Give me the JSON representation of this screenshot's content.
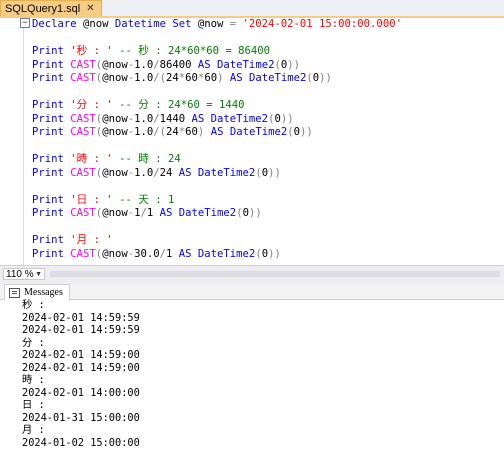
{
  "tab": {
    "title": "SQLQuery1.sql",
    "close_glyph": "✕"
  },
  "editor": {
    "lines": [
      [
        [
          "kw",
          "Declare "
        ],
        [
          "var",
          "@now "
        ],
        [
          "kw",
          "Datetime "
        ],
        [
          "kw",
          "Set "
        ],
        [
          "var",
          "@now "
        ],
        [
          "op",
          "= "
        ],
        [
          "str",
          "'2024-02-01 15:00:00.000'"
        ]
      ],
      [],
      [
        [
          "kw",
          "Print "
        ],
        [
          "str",
          "'秒 : ' "
        ],
        [
          "cm",
          "-- 秒 : 24*60*60 = 86400"
        ]
      ],
      [
        [
          "kw",
          "Print "
        ],
        [
          "fn",
          "CAST"
        ],
        [
          "op",
          "("
        ],
        [
          "var",
          "@now"
        ],
        [
          "op",
          "-"
        ],
        [
          "var",
          "1.0"
        ],
        [
          "op",
          "/"
        ],
        [
          "var",
          "86400 "
        ],
        [
          "kw",
          "AS "
        ],
        [
          "kw",
          "DateTime2"
        ],
        [
          "op",
          "("
        ],
        [
          "var",
          "0"
        ],
        [
          "op",
          "))"
        ]
      ],
      [
        [
          "kw",
          "Print "
        ],
        [
          "fn",
          "CAST"
        ],
        [
          "op",
          "("
        ],
        [
          "var",
          "@now"
        ],
        [
          "op",
          "-"
        ],
        [
          "var",
          "1.0"
        ],
        [
          "op",
          "/("
        ],
        [
          "var",
          "24"
        ],
        [
          "op",
          "*"
        ],
        [
          "var",
          "60"
        ],
        [
          "op",
          "*"
        ],
        [
          "var",
          "60"
        ],
        [
          "op",
          ") "
        ],
        [
          "kw",
          "AS "
        ],
        [
          "kw",
          "DateTime2"
        ],
        [
          "op",
          "("
        ],
        [
          "var",
          "0"
        ],
        [
          "op",
          "))"
        ]
      ],
      [],
      [
        [
          "kw",
          "Print "
        ],
        [
          "str",
          "'分 : ' "
        ],
        [
          "cm",
          "-- 分 : 24*60 = 1440"
        ]
      ],
      [
        [
          "kw",
          "Print "
        ],
        [
          "fn",
          "CAST"
        ],
        [
          "op",
          "("
        ],
        [
          "var",
          "@now"
        ],
        [
          "op",
          "-"
        ],
        [
          "var",
          "1.0"
        ],
        [
          "op",
          "/"
        ],
        [
          "var",
          "1440 "
        ],
        [
          "kw",
          "AS "
        ],
        [
          "kw",
          "DateTime2"
        ],
        [
          "op",
          "("
        ],
        [
          "var",
          "0"
        ],
        [
          "op",
          "))"
        ]
      ],
      [
        [
          "kw",
          "Print "
        ],
        [
          "fn",
          "CAST"
        ],
        [
          "op",
          "("
        ],
        [
          "var",
          "@now"
        ],
        [
          "op",
          "-"
        ],
        [
          "var",
          "1.0"
        ],
        [
          "op",
          "/("
        ],
        [
          "var",
          "24"
        ],
        [
          "op",
          "*"
        ],
        [
          "var",
          "60"
        ],
        [
          "op",
          ") "
        ],
        [
          "kw",
          "AS "
        ],
        [
          "kw",
          "DateTime2"
        ],
        [
          "op",
          "("
        ],
        [
          "var",
          "0"
        ],
        [
          "op",
          "))"
        ]
      ],
      [],
      [
        [
          "kw",
          "Print "
        ],
        [
          "str",
          "'時 : ' "
        ],
        [
          "cm",
          "-- 時 : 24"
        ]
      ],
      [
        [
          "kw",
          "Print "
        ],
        [
          "fn",
          "CAST"
        ],
        [
          "op",
          "("
        ],
        [
          "var",
          "@now"
        ],
        [
          "op",
          "-"
        ],
        [
          "var",
          "1.0"
        ],
        [
          "op",
          "/"
        ],
        [
          "var",
          "24 "
        ],
        [
          "kw",
          "AS "
        ],
        [
          "kw",
          "DateTime2"
        ],
        [
          "op",
          "("
        ],
        [
          "var",
          "0"
        ],
        [
          "op",
          "))"
        ]
      ],
      [],
      [
        [
          "kw",
          "Print "
        ],
        [
          "str",
          "'日 : ' "
        ],
        [
          "cm",
          "-- 天 : 1"
        ]
      ],
      [
        [
          "kw",
          "Print "
        ],
        [
          "fn",
          "CAST"
        ],
        [
          "op",
          "("
        ],
        [
          "var",
          "@now"
        ],
        [
          "op",
          "-"
        ],
        [
          "var",
          "1"
        ],
        [
          "op",
          "/"
        ],
        [
          "var",
          "1 "
        ],
        [
          "kw",
          "AS "
        ],
        [
          "kw",
          "DateTime2"
        ],
        [
          "op",
          "("
        ],
        [
          "var",
          "0"
        ],
        [
          "op",
          "))"
        ]
      ],
      [],
      [
        [
          "kw",
          "Print "
        ],
        [
          "str",
          "'月 : '"
        ]
      ],
      [
        [
          "kw",
          "Print "
        ],
        [
          "fn",
          "CAST"
        ],
        [
          "op",
          "("
        ],
        [
          "var",
          "@now"
        ],
        [
          "op",
          "-"
        ],
        [
          "var",
          "30.0"
        ],
        [
          "op",
          "/"
        ],
        [
          "var",
          "1 "
        ],
        [
          "kw",
          "AS "
        ],
        [
          "kw",
          "DateTime2"
        ],
        [
          "op",
          "("
        ],
        [
          "var",
          "0"
        ],
        [
          "op",
          "))"
        ]
      ]
    ]
  },
  "zoom": {
    "value": "110 %"
  },
  "results": {
    "tab_label": "Messages",
    "messages": [
      "秒 :",
      "2024-02-01 14:59:59",
      "2024-02-01 14:59:59",
      "分 :",
      "2024-02-01 14:59:00",
      "2024-02-01 14:59:00",
      "時 :",
      "2024-02-01 14:00:00",
      "日 :",
      "2024-01-31 15:00:00",
      "月 :",
      "2024-01-02 15:00:00"
    ]
  }
}
